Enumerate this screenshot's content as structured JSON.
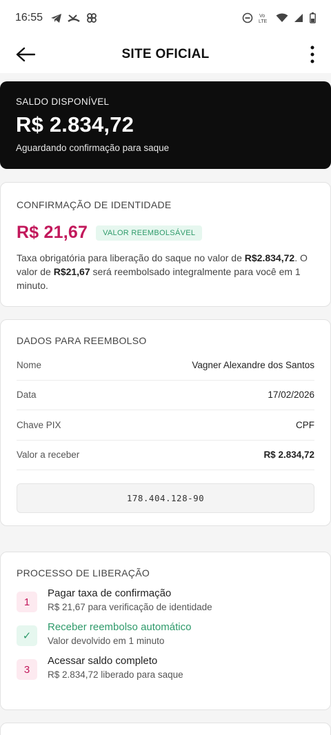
{
  "status_bar": {
    "time": "16:55",
    "left_icons": [
      "telegram-icon",
      "missed-call-icon",
      "pinwheel-icon"
    ],
    "right_icons": [
      "do-not-disturb-icon",
      "volte-icon",
      "wifi-icon",
      "signal-icon",
      "battery-icon"
    ],
    "volte_text": "Vo LTE"
  },
  "app_bar": {
    "title": "SITE OFICIAL"
  },
  "balance": {
    "label": "SALDO DISPONÍVEL",
    "amount": "R$ 2.834,72",
    "subtitle": "Aguardando confirmação para saque"
  },
  "identity": {
    "title": "CONFIRMAÇÃO DE IDENTIDADE",
    "fee": "R$ 21,67",
    "badge": "VALOR REEMBOLSÁVEL",
    "desc_1": "Taxa obrigatória para liberação do saque no valor de ",
    "desc_amount": "R$2.834,72",
    "desc_2": ". O valor de ",
    "desc_fee": "R$21,67",
    "desc_3": " será reembolsado integralmente para você em 1 minuto."
  },
  "refund": {
    "title": "DADOS PARA REEMBOLSO",
    "rows": [
      {
        "label": "Nome",
        "value": "Vagner Alexandre dos Santos"
      },
      {
        "label": "Data",
        "value": "17/02/2026"
      },
      {
        "label": "Chave PIX",
        "value": "CPF"
      },
      {
        "label": "Valor a receber",
        "value": "R$ 2.834,72"
      }
    ],
    "pix_key": "178.404.128-90"
  },
  "process": {
    "title": "PROCESSO DE LIBERAÇÃO",
    "steps": [
      {
        "marker": "1",
        "title": "Pagar taxa de confirmação",
        "subtitle": "R$ 21,67 para verificação de identidade"
      },
      {
        "marker": "✓",
        "title": "Receber reembolso automático",
        "subtitle": "Valor devolvido em 1 minuto"
      },
      {
        "marker": "3",
        "title": "Acessar saldo completo",
        "subtitle": "R$ 2.834,72 liberado para saque"
      }
    ]
  },
  "colors": {
    "accent_pink": "#c2185b",
    "success_green": "#2e9a6a",
    "balance_bg": "#0d0d0d"
  }
}
